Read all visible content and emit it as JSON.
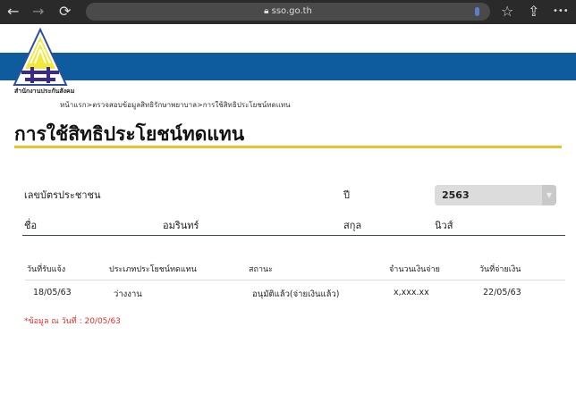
{
  "browser": {
    "url": "sso.go.th",
    "back_icon": "←",
    "forward_icon": "→",
    "reload_icon": "⟳",
    "star_icon": "☆",
    "share_icon": "⇪",
    "more_icon": "•••"
  },
  "header": {
    "logo_text": "สำนักงานประกันสังคม",
    "breadcrumb": "หน้าแรก>ตรวจสอบข้อมูลสิทธิรักษาพยาบาล>การใช้สิทธิประโยชน์ทดแทน",
    "colors": {
      "band": "#0e5c9e",
      "accent": "#e8c22e"
    }
  },
  "page": {
    "title": "การใช้สิทธิประโยชน์ทดแทน"
  },
  "form": {
    "id_label": "เลขบัตรประชาชน",
    "year_label": "ปี",
    "year_value": "2563",
    "name_label": "ชื่อ",
    "name_value": "อมรินทร์",
    "surname_label": "สกุล",
    "surname_value": "นิวส์"
  },
  "table": {
    "headers": [
      "วันที่รับแจ้ง",
      "ประเภทประโยชน์ทดแทน",
      "สถานะ",
      "จำนวนเงินจ่าย",
      "วันที่จ่ายเงิน"
    ],
    "rows": [
      [
        "18/05/63",
        "ว่างงาน",
        "อนุมัติแล้ว(จ่ายเงินแล้ว)",
        "x,xxx.xx",
        "22/05/63"
      ]
    ]
  },
  "note": "*ข้อมูล ณ วันที่ : 20/05/63"
}
